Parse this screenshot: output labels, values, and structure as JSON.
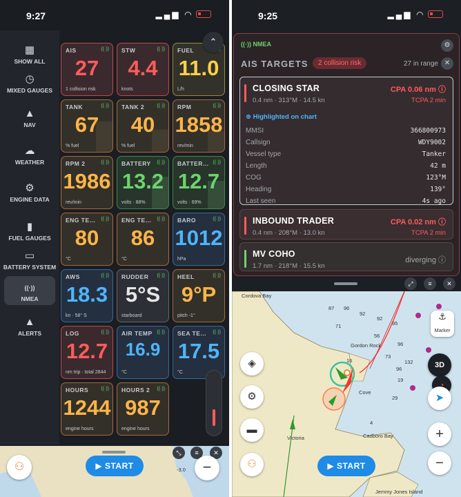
{
  "left_phone": {
    "status": {
      "time": "9:27"
    },
    "sidebar": [
      {
        "label": "SHOW ALL",
        "icon": "grid-icon"
      },
      {
        "label": "MIXED GAUGES",
        "icon": "gauge-icon"
      },
      {
        "label": "NAV",
        "icon": "nav-arrow-icon"
      },
      {
        "label": "WEATHER",
        "icon": "weather-icon"
      },
      {
        "label": "ENGINE DATA",
        "icon": "engine-icon"
      },
      {
        "label": "FUEL GAUGES",
        "icon": "fuel-icon"
      },
      {
        "label": "BATTERY SYSTEM",
        "icon": "battery-icon"
      },
      {
        "label": "NMEA",
        "icon": "antenna-icon"
      },
      {
        "label": "ALERTS",
        "icon": "warning-icon"
      }
    ],
    "gauges": [
      {
        "label": "AIS",
        "value": "27",
        "sub": "1 collision risk",
        "color": "red"
      },
      {
        "label": "STW",
        "value": "4.4",
        "sub": "knots",
        "color": "red"
      },
      {
        "label": "FUEL",
        "value": "11.0",
        "sub": "L/h",
        "color": "yellow"
      },
      {
        "label": "TANK",
        "value": "67",
        "sub": "% fuel",
        "color": "orange"
      },
      {
        "label": "TANK 2",
        "value": "40",
        "sub": "% fuel",
        "color": "orange"
      },
      {
        "label": "RPM",
        "value": "1858",
        "sub": "rev/min",
        "color": "orange"
      },
      {
        "label": "RPM 2",
        "value": "1986",
        "sub": "rev/min",
        "color": "orange"
      },
      {
        "label": "BATTERY",
        "value": "13.2",
        "sub": "volts · 88%",
        "color": "green"
      },
      {
        "label": "BATTER…",
        "value": "12.7",
        "sub": "volts · 69%",
        "color": "green"
      },
      {
        "label": "ENG TE…",
        "value": "80",
        "sub": "°C",
        "color": "orange"
      },
      {
        "label": "ENG TE…",
        "value": "86",
        "sub": "°C",
        "color": "orange"
      },
      {
        "label": "BARO",
        "value": "1012",
        "sub": "hPa",
        "color": "blue"
      },
      {
        "label": "AWS",
        "value": "18.3",
        "sub": "kn · 58° S",
        "color": "blue"
      },
      {
        "label": "RUDDER",
        "value": "5°S",
        "sub": "starboard",
        "color": "gray"
      },
      {
        "label": "HEEL",
        "value": "9°P",
        "sub": "pitch -1°",
        "color": "orange"
      },
      {
        "label": "LOG",
        "value": "12.7",
        "sub": "nm trip · total 2844",
        "color": "red"
      },
      {
        "label": "AIR TEMP",
        "value": "16.9",
        "sub": "°C",
        "color": "blue"
      },
      {
        "label": "SEA TE…",
        "value": "17.5",
        "sub": "°C",
        "color": "blue"
      },
      {
        "label": "HOURS",
        "value": "1244",
        "sub": "engine hours",
        "color": "orange"
      },
      {
        "label": "HOURS 2",
        "value": "987",
        "sub": "engine hours",
        "color": "orange"
      }
    ],
    "start_label": "START",
    "map_fragment": "-3.0"
  },
  "right_phone": {
    "status": {
      "time": "9:25"
    },
    "nmea_label": "NMEA",
    "ais_title": "AIS TARGETS",
    "collision_badge": "2 collision risk",
    "range_text": "27 in range",
    "highlight_note": "Highlighted on chart",
    "targets": [
      {
        "name": "CLOSING STAR",
        "meta": "0.4 nm · 313°M · 14.5 kn",
        "cpa": "CPA 0.06 nm",
        "tcpa": "TCPA 2 min",
        "status_color": "#ff5c5c"
      },
      {
        "name": "INBOUND TRADER",
        "meta": "0.4 nm · 208°M · 13.0 kn",
        "cpa": "CPA 0.02 nm",
        "tcpa": "TCPA 2 min",
        "status_color": "#ff5c5c"
      },
      {
        "name": "MV COHO",
        "meta": "1.7 nm · 218°M · 15.5 kn",
        "cpa": "diverging",
        "tcpa": "",
        "status_color": "#6ed26e"
      }
    ],
    "details": [
      {
        "key": "MMSI",
        "value": "366800973"
      },
      {
        "key": "Callsign",
        "value": "WDY9002"
      },
      {
        "key": "Vessel type",
        "value": "Tanker"
      },
      {
        "key": "Length",
        "value": "42 m"
      },
      {
        "key": "COG",
        "value": "123°M"
      },
      {
        "key": "Heading",
        "value": "139°"
      },
      {
        "key": "Last seen",
        "value": "4s ago"
      }
    ],
    "map": {
      "labels": [
        "Cordova Bay",
        "Gordon Rock",
        "Cadboro Bay",
        "Victoria",
        "Jemmy Jones Island",
        "Cove"
      ],
      "soundings": [
        "87",
        "96",
        "92",
        "92",
        "95",
        "71",
        "56",
        "96",
        "73",
        "96",
        "132",
        "29",
        "4",
        "16",
        "19"
      ],
      "marker_label": "Marker",
      "three_d": "3D",
      "start_label": "START"
    }
  }
}
